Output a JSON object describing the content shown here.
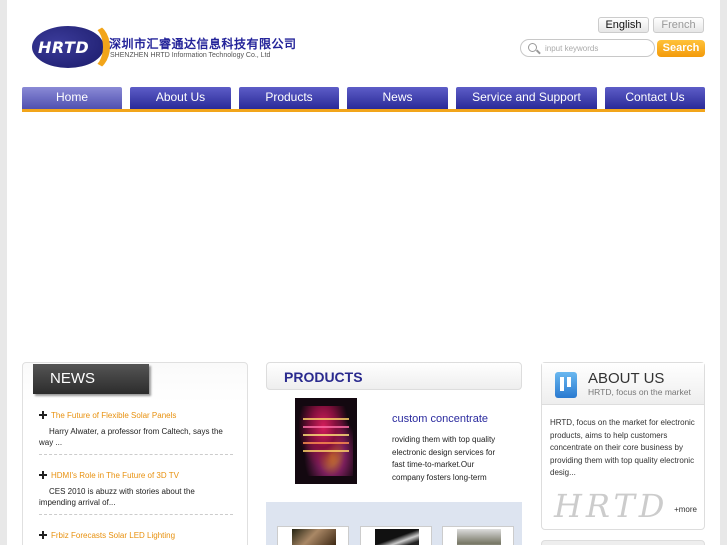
{
  "header": {
    "logo_text": "HRTD",
    "company_cn": "深圳市汇睿通达信息科技有限公司",
    "company_en": "SHENZHEN HRTD Information Technology Co., Ltd",
    "languages": [
      "English",
      "French"
    ],
    "search": {
      "placeholder": "input keywords",
      "button": "Search"
    }
  },
  "nav": {
    "items": [
      "Home",
      "About Us",
      "Products",
      "News",
      "Service and Support",
      "Contact Us"
    ],
    "active": "Home"
  },
  "news": {
    "title": "NEWS",
    "items": [
      {
        "title": "The Future of Flexible Solar Panels",
        "summary": "Harry Alwater, a professor from Caltech, says the way ..."
      },
      {
        "title": "HDMI's Role in The Future of 3D TV",
        "summary": "CES 2010 is abuzz with stories about the impending arrival of..."
      },
      {
        "title": "Frbiz Forecasts Solar LED Lighting",
        "summary": ""
      }
    ]
  },
  "products": {
    "title": "PRODUCTS",
    "featured_name": "custom concentrate",
    "featured_desc": "roviding them with top quality electronic design services for fast time-to-market.Our company fosters long-term"
  },
  "about": {
    "title": "ABOUT US",
    "subtitle": "HRTD, focus on the market",
    "text": "HRTD, focus on the market for electronic products, aims to help customers concentrate on their core business by providing them with top quality electronic desig...",
    "signature": "HRTD",
    "more": "+more"
  },
  "colors": {
    "nav": "#2a2a98",
    "accent": "#f2a51a",
    "brand": "#24249a"
  }
}
